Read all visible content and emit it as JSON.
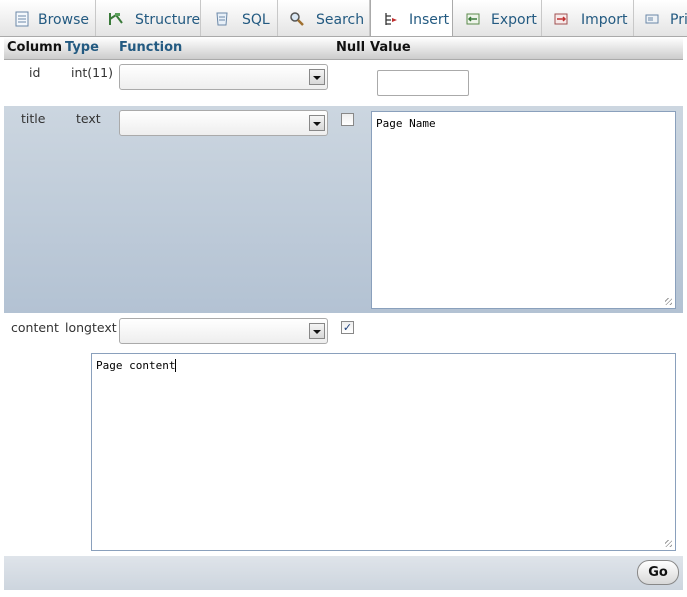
{
  "tabs": [
    {
      "label": "Browse",
      "icon": "browse-icon"
    },
    {
      "label": "Structure",
      "icon": "structure-icon"
    },
    {
      "label": "SQL",
      "icon": "sql-icon"
    },
    {
      "label": "Search",
      "icon": "search-icon"
    },
    {
      "label": "Insert",
      "icon": "insert-icon",
      "active": true
    },
    {
      "label": "Export",
      "icon": "export-icon"
    },
    {
      "label": "Import",
      "icon": "import-icon"
    },
    {
      "label": "Pri",
      "icon": "privileges-icon"
    }
  ],
  "table": {
    "headers": {
      "column": "Column",
      "type": "Type",
      "function": "Function",
      "null": "Null",
      "value": "Value"
    },
    "rows": [
      {
        "column": "id",
        "type": "int(11)",
        "function": "",
        "null_checked": false,
        "value": ""
      },
      {
        "column": "title",
        "type": "text",
        "function": "",
        "null_checked": false,
        "value": "Page Name"
      },
      {
        "column": "content",
        "type": "longtext",
        "function": "",
        "null_checked": true,
        "value": "Page content"
      }
    ]
  },
  "footer": {
    "go_label": "Go"
  },
  "colors": {
    "link": "#235a81",
    "row_shade": "#b3c2d3"
  }
}
